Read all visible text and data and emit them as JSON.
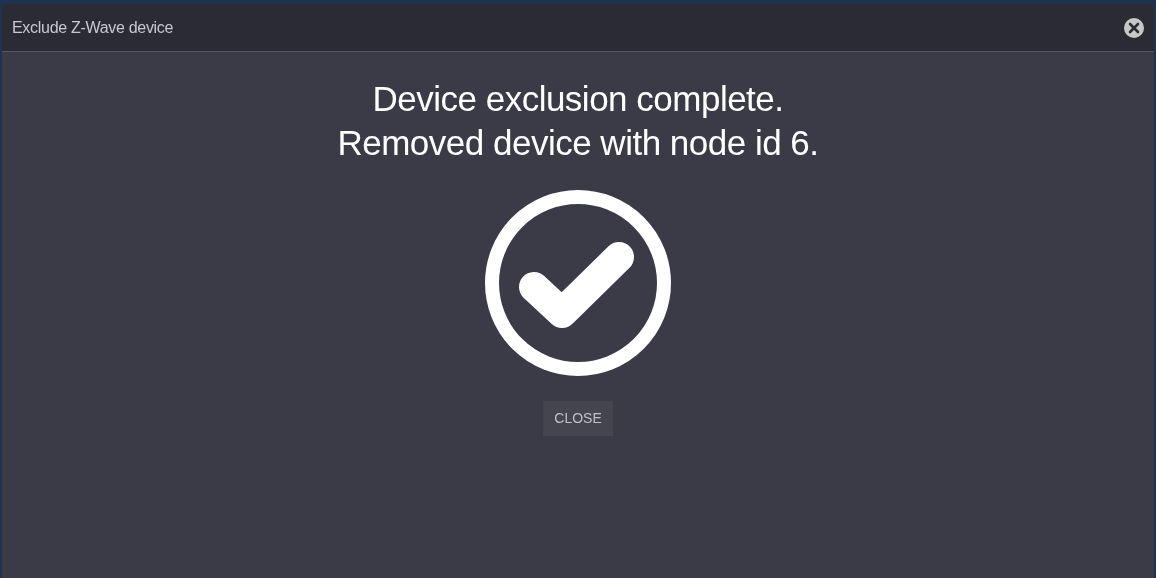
{
  "dialog": {
    "title": "Exclude Z-Wave device",
    "message_lines": [
      "Device exclusion complete.",
      "Removed device with node id 6."
    ],
    "buttons": [
      "CLOSE"
    ]
  }
}
